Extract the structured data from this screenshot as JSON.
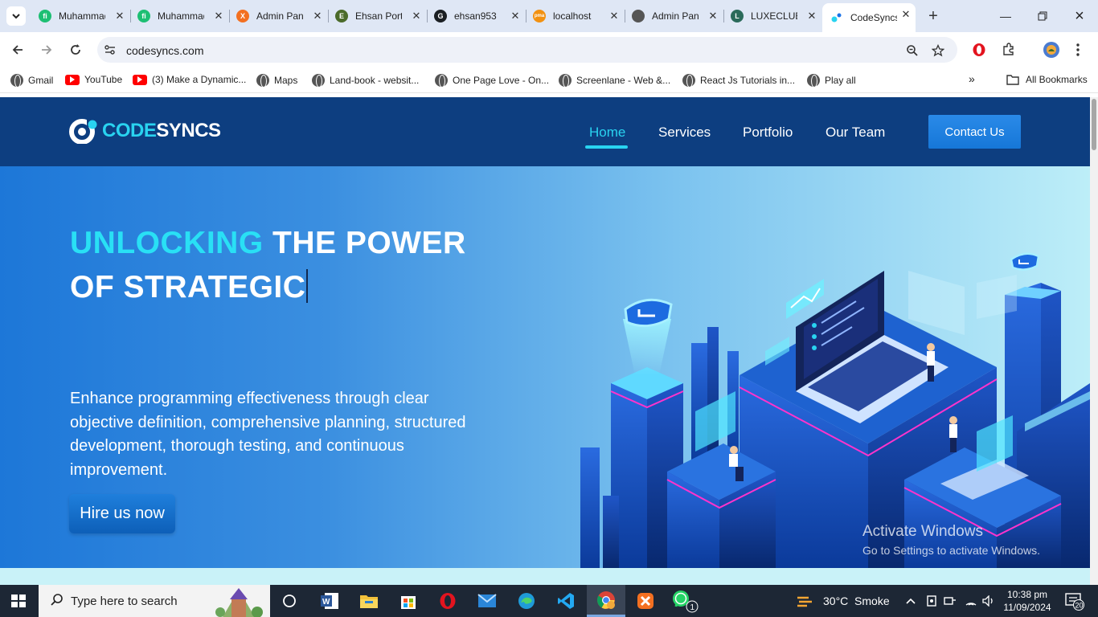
{
  "browser": {
    "tabs": [
      {
        "title": "Muhammad Ehsan",
        "favicon": "fiverr-icon",
        "color": "#1dbf73",
        "glyph": "fi"
      },
      {
        "title": "Muhammad Ehsan",
        "favicon": "fiverr-icon",
        "color": "#1dbf73",
        "glyph": "fi"
      },
      {
        "title": "Admin Panel",
        "favicon": "xampp-icon",
        "color": "#f37021",
        "glyph": "X"
      },
      {
        "title": "Ehsan Portfolio",
        "favicon": "portfolio-icon",
        "color": "#4b6b2a",
        "glyph": "E"
      },
      {
        "title": "ehsan953",
        "favicon": "github-icon",
        "color": "#1b1f23",
        "glyph": "G"
      },
      {
        "title": "localhost",
        "favicon": "phpmyadmin-icon",
        "color": "#f29111",
        "glyph": "pma"
      },
      {
        "title": "Admin Panel",
        "favicon": "globe-icon",
        "color": "#555555",
        "glyph": ""
      },
      {
        "title": "LUXECLUB",
        "favicon": "luxeclub-icon",
        "color": "#2a6a5a",
        "glyph": "L"
      },
      {
        "title": "CodeSyncs",
        "favicon": "codesyncs-icon",
        "color": "#29d3f0",
        "glyph": "",
        "active": true
      }
    ],
    "url": "codesyncs.com",
    "bookmarks": [
      {
        "label": "Gmail",
        "icon": "globe-icon"
      },
      {
        "label": "YouTube",
        "icon": "youtube-icon"
      },
      {
        "label": "(3) Make a Dynamic...",
        "icon": "youtube-icon"
      },
      {
        "label": "Maps",
        "icon": "globe-icon"
      },
      {
        "label": "Land-book - websit...",
        "icon": "globe-icon"
      },
      {
        "label": "One Page Love - On...",
        "icon": "globe-icon"
      },
      {
        "label": "Screenlane - Web &...",
        "icon": "globe-icon"
      },
      {
        "label": "React Js Tutorials in...",
        "icon": "globe-icon"
      },
      {
        "label": "Play all",
        "icon": "globe-icon"
      }
    ],
    "bookmarks_overflow": "»",
    "all_bookmarks": "All Bookmarks"
  },
  "site": {
    "logo_part1": "CODE",
    "logo_part2": "SYNCS",
    "nav": [
      "Home",
      "Services",
      "Portfolio",
      "Our Team"
    ],
    "nav_active": "Home",
    "contact": "Contact Us",
    "hero": {
      "title_accent": "UNLOCKING",
      "title_rest": " THE POWER",
      "title_line2": "OF STRATEGIC",
      "description": "Enhance programming effectiveness through clear objective definition, comprehensive planning, structured development, thorough testing, and continuous improvement.",
      "cta": "Hire us now"
    },
    "accent_color": "#29d3f0",
    "header_color": "#0d3e80"
  },
  "watermark": {
    "line1": "Activate Windows",
    "line2": "Go to Settings to activate Windows."
  },
  "taskbar": {
    "search_placeholder": "Type here to search",
    "weather": "30°C  Smoke",
    "time": "10:38 pm",
    "date": "11/09/2024",
    "notification_count": "20",
    "whatsapp_badge": "1"
  }
}
